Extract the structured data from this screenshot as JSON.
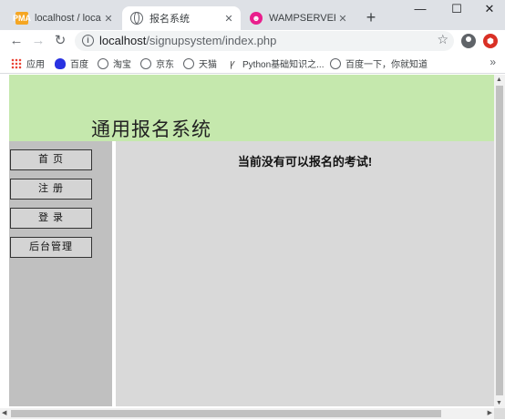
{
  "browser": {
    "tabs": [
      {
        "label": "localhost / localhost",
        "favicon": "phpmyadmin-icon"
      },
      {
        "label": "报名系统",
        "favicon": "globe-icon"
      },
      {
        "label": "WAMPSERVER Ho",
        "favicon": "wampserver-icon"
      }
    ],
    "new_tab_glyph": "+",
    "window_controls": {
      "minimize": "—",
      "maximize": "☐",
      "close": "✕"
    },
    "address": {
      "host": "localhost",
      "path": "/signupsystem/index.php"
    },
    "bookmarks": [
      {
        "label": "应用",
        "icon": "apps-grid-icon"
      },
      {
        "label": "百度",
        "icon": "baidu-icon"
      },
      {
        "label": "淘宝",
        "icon": "globe-icon"
      },
      {
        "label": "京东",
        "icon": "globe-icon"
      },
      {
        "label": "天猫",
        "icon": "globe-icon"
      },
      {
        "label": "Python基础知识之...",
        "icon": "python-icon"
      },
      {
        "label": "百度一下，你就知道",
        "icon": "globe-icon"
      }
    ],
    "bookmarks_more": "»"
  },
  "page": {
    "header_title": "通用报名系统",
    "nav": [
      {
        "label": "首 页"
      },
      {
        "label": "注 册"
      },
      {
        "label": "登 录"
      },
      {
        "label": "后台管理"
      }
    ],
    "notice": "当前没有可以报名的考试!"
  },
  "colors": {
    "header_bg": "#c5e8ad",
    "sidebar_bg": "#c0c0c0",
    "main_bg": "#d9d9d9",
    "tabstrip_bg": "#dee1e6"
  }
}
